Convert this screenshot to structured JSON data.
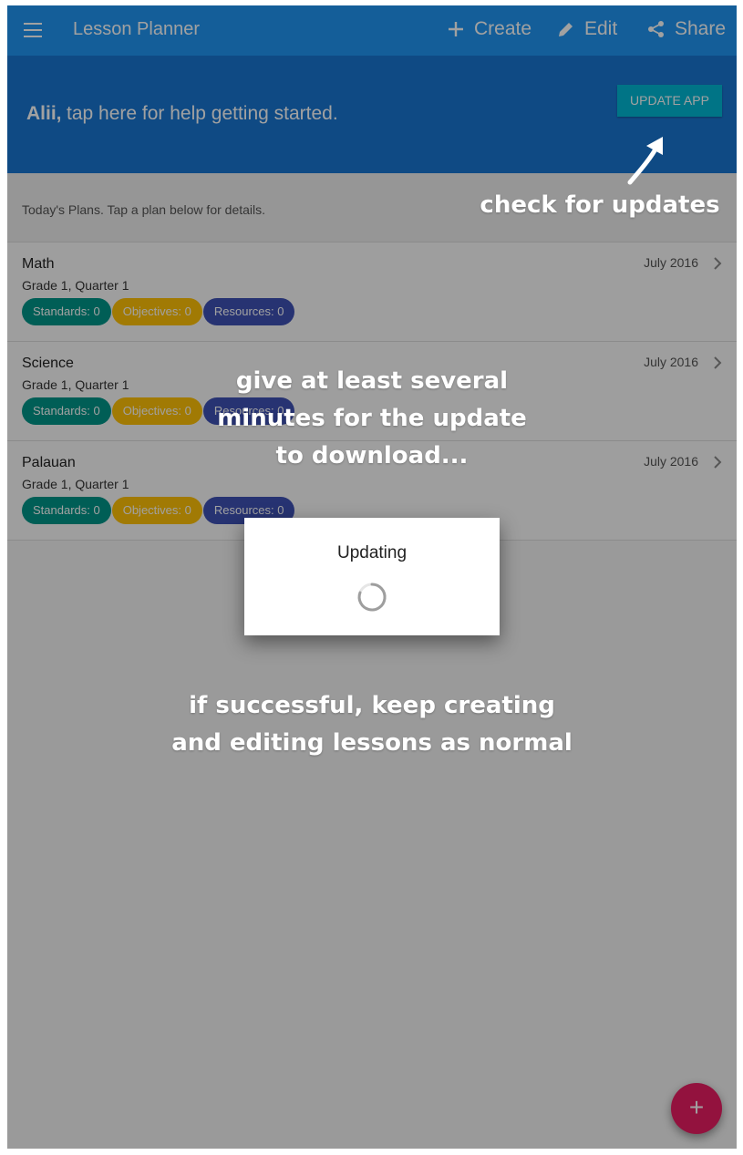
{
  "toolbar": {
    "title": "Lesson Planner",
    "menu_icon": "hamburger-menu-icon",
    "actions": [
      {
        "label": "Create",
        "icon": "plus-icon"
      },
      {
        "label": "Edit",
        "icon": "pencil-icon"
      },
      {
        "label": "Share",
        "icon": "share-icon"
      }
    ]
  },
  "banner": {
    "user": "Alii,",
    "text": "tap here for help getting started.",
    "update_button": "UPDATE APP"
  },
  "list_header": "Today's Plans. Tap a plan below for details.",
  "plans": [
    {
      "title": "Math",
      "subtitle": "Grade 1, Quarter 1",
      "date": "July 2016",
      "standards": "Standards: 0",
      "objectives": "Objectives: 0",
      "resources": "Resources: 0"
    },
    {
      "title": "Science",
      "subtitle": "Grade 1, Quarter 1",
      "date": "July 2016",
      "standards": "Standards: 0",
      "objectives": "Objectives: 0",
      "resources": "Resources: 0"
    },
    {
      "title": "Palauan",
      "subtitle": "Grade 1, Quarter 1",
      "date": "July 2016",
      "standards": "Standards: 0",
      "objectives": "Objectives: 0",
      "resources": "Resources: 0"
    }
  ],
  "dialog": {
    "title": "Updating"
  },
  "fab": {
    "label": "+"
  },
  "annotations": {
    "check": "check for updates",
    "wait_1": "give at least several",
    "wait_2": "minutes for the update",
    "wait_3": "to download...",
    "success_1": "if successful, keep creating",
    "success_2": "and editing lessons as normal"
  },
  "colors": {
    "toolbar": "#2196f3",
    "banner": "#1976d2",
    "update_button": "#00b8d4",
    "standards_chip": "#009688",
    "objectives_chip": "#ffc107",
    "resources_chip": "#3f51b5",
    "fab": "#e91e63"
  }
}
